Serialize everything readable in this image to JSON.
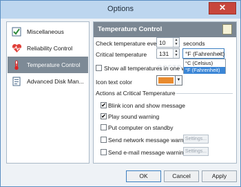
{
  "window": {
    "title": "Options",
    "close_glyph": "✕"
  },
  "sidebar": {
    "items": [
      {
        "label": "Miscellaneous",
        "icon": "check-list-icon",
        "selected": false
      },
      {
        "label": "Reliability Control",
        "icon": "heart-pulse-icon",
        "selected": false
      },
      {
        "label": "Temperature Control",
        "icon": "thermometer-icon",
        "selected": true
      },
      {
        "label": "Advanced Disk Man...",
        "icon": "disk-document-icon",
        "selected": false
      }
    ]
  },
  "panel": {
    "title": "Temperature Control",
    "check_every": {
      "label": "Check temperature every",
      "value": "10",
      "unit": "seconds"
    },
    "critical": {
      "label": "Critical temperature",
      "value": "131",
      "unit_selected": "°F (Fahrenheit)",
      "unit_options": [
        "°C (Celsius)",
        "°F (Fahrenheit)"
      ],
      "highlighted_option": "°F (Fahrenheit)"
    },
    "show_all": {
      "label": "Show all temperatures in one window",
      "checked": false
    },
    "icon_color": {
      "label": "Icon text color",
      "color": "#e88a2e"
    },
    "actions_heading": "Actions at Critical Temperature",
    "actions": [
      {
        "label": "Blink icon and show message",
        "checked": true
      },
      {
        "label": "Play sound warning",
        "checked": true
      },
      {
        "label": "Put computer on standby",
        "checked": false
      },
      {
        "label": "Send network message warning",
        "checked": false,
        "settings_label": "Settings..."
      },
      {
        "label": "Send e-mail message warning",
        "checked": false,
        "settings_label": "Settings..."
      }
    ],
    "watermark": "SOFTP"
  },
  "footer": {
    "ok_label": "OK",
    "cancel_label": "Cancel",
    "apply_label": "Apply"
  },
  "check_glyph": "✔"
}
